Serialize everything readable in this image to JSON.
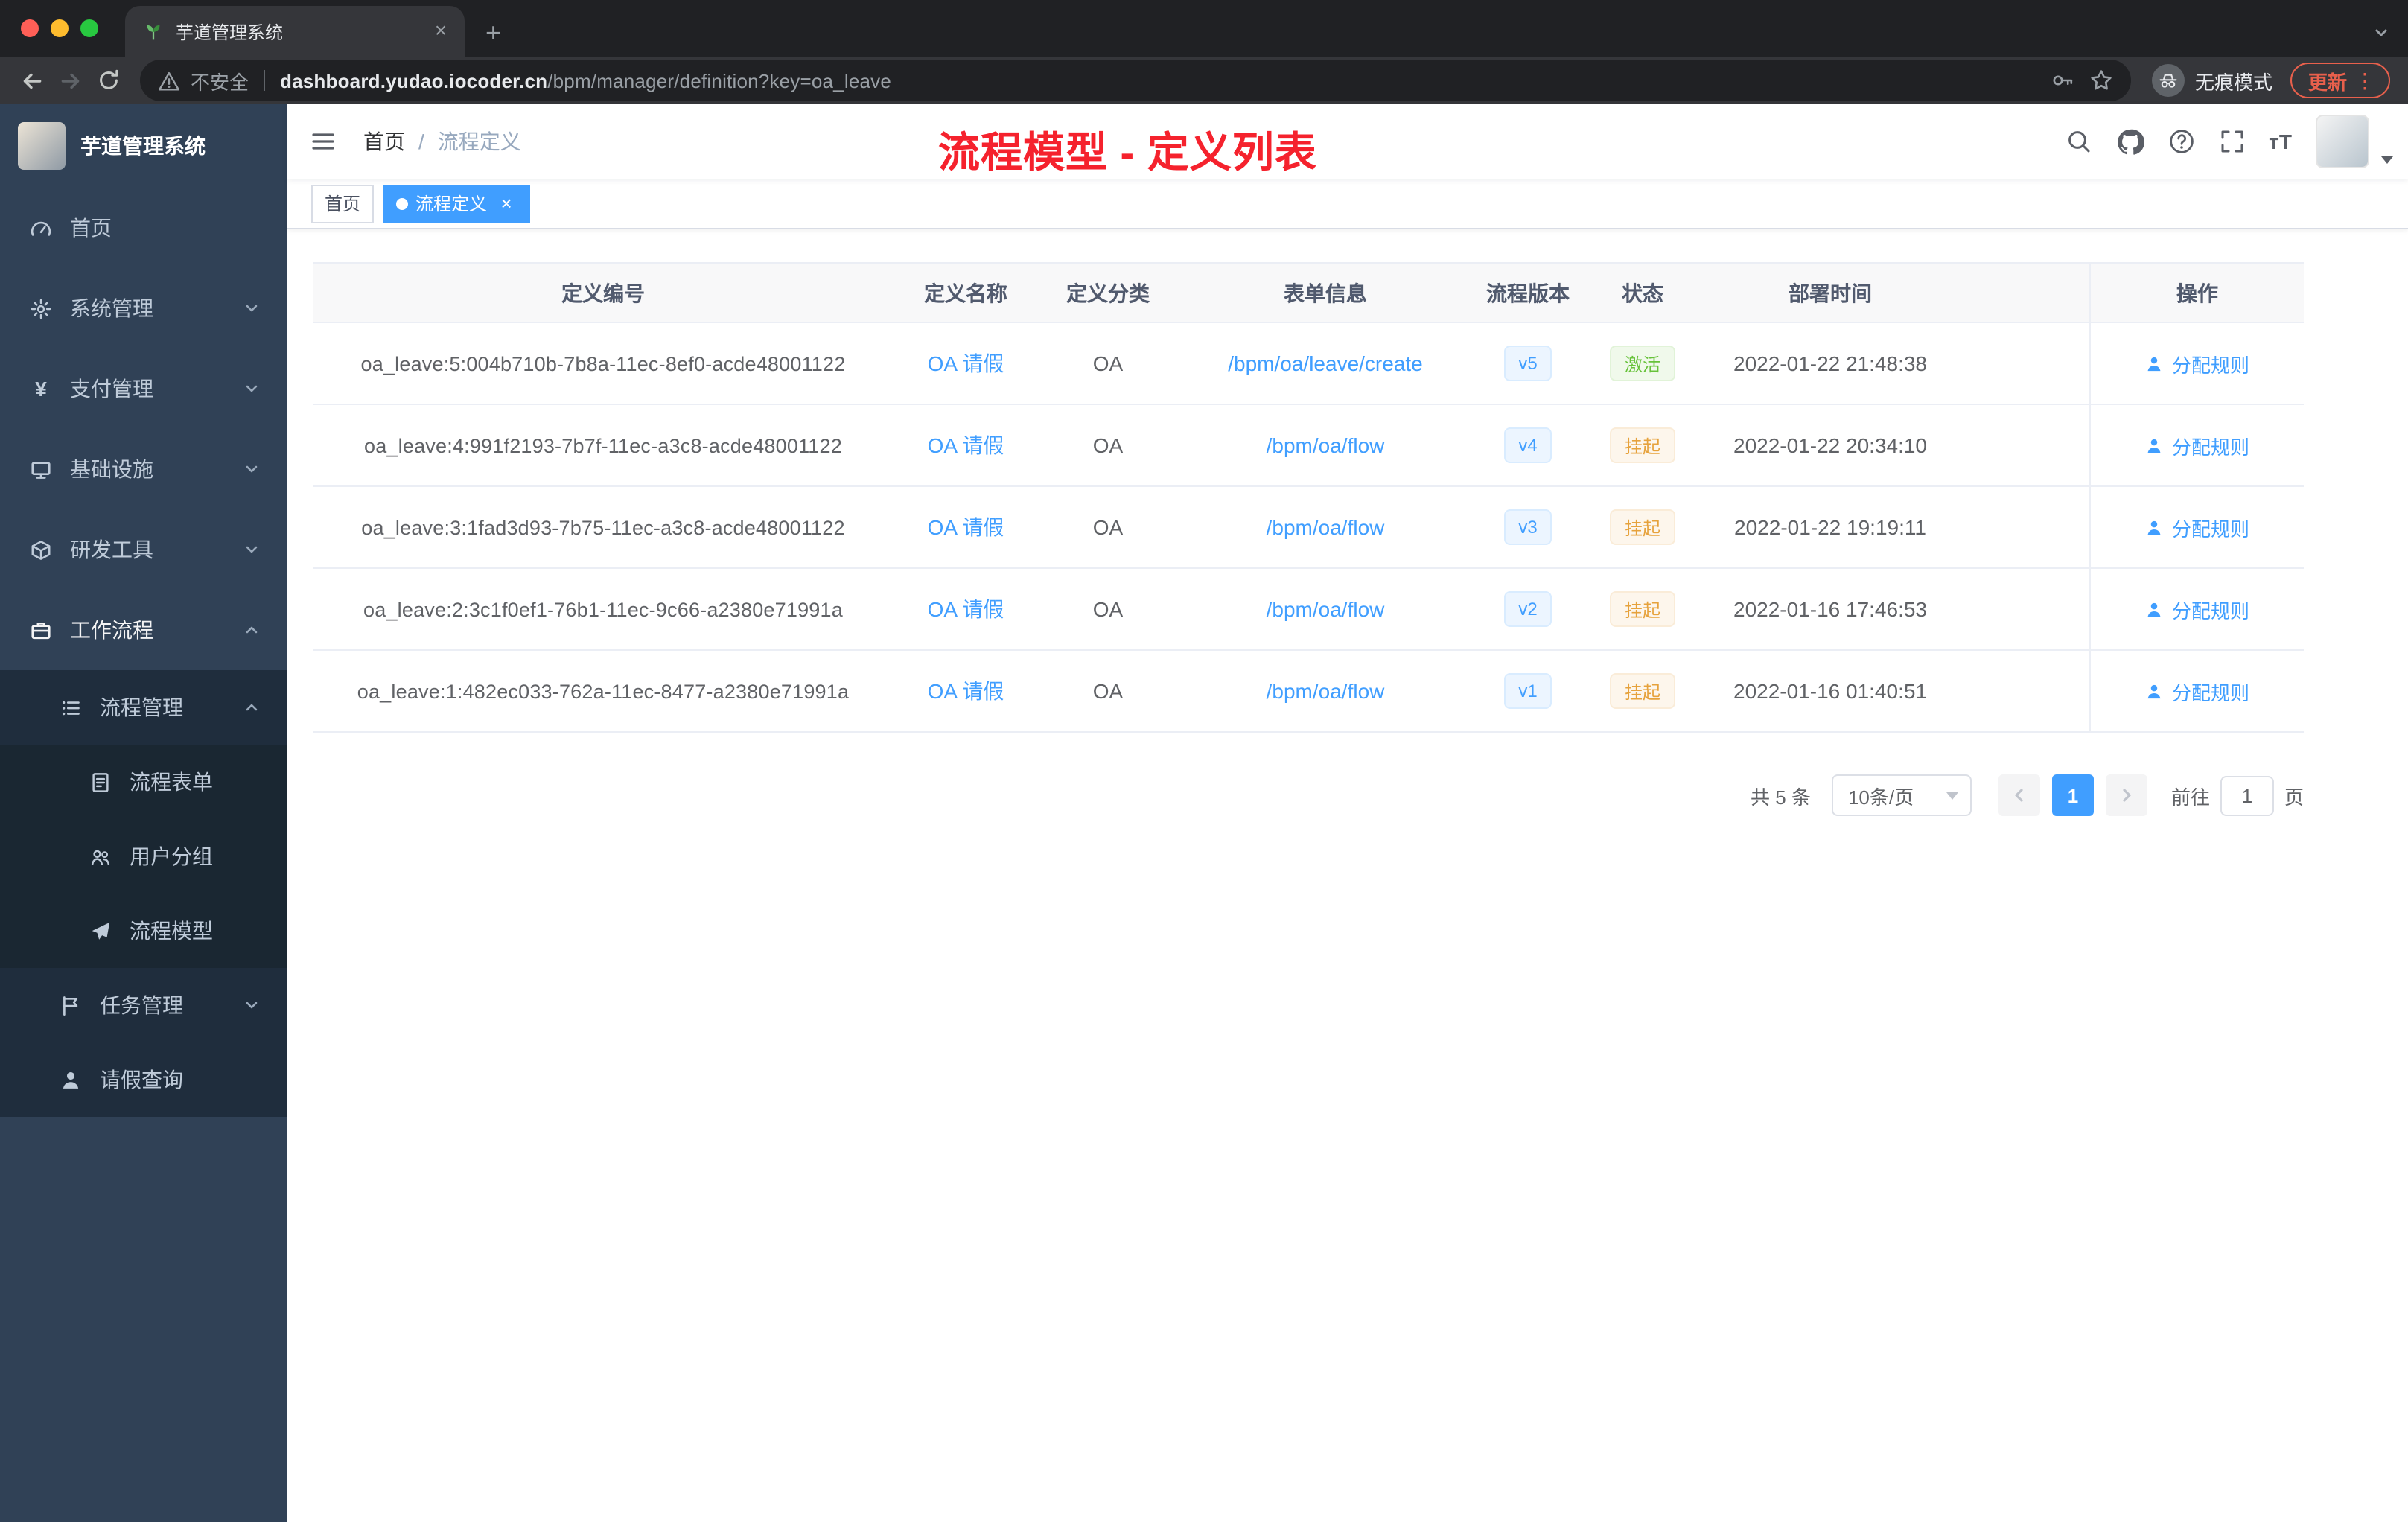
{
  "colors": {
    "accent": "#409eff",
    "success": "#67c23a",
    "warning": "#e6a23c",
    "annotation_red": "#f5222d",
    "sidebar_bg": "#304156",
    "sidebar_submenu_bg": "#1f2d3d",
    "update_pill": "#e8604c"
  },
  "browser": {
    "tab_title": "芋道管理系统",
    "security_label": "不安全",
    "url_host": "dashboard.yudao.iocoder.cn",
    "url_path": "/bpm/manager/definition?key=oa_leave",
    "incognito_label": "无痕模式",
    "update_label": "更新"
  },
  "sidebar": {
    "logo_title": "芋道管理系统",
    "items": [
      {
        "label": "首页",
        "icon": "dashboard-icon"
      },
      {
        "label": "系统管理",
        "icon": "gear-icon"
      },
      {
        "label": "支付管理",
        "icon": "yen-icon"
      },
      {
        "label": "基础设施",
        "icon": "infrastructure-icon"
      },
      {
        "label": "研发工具",
        "icon": "tools-icon"
      },
      {
        "label": "工作流程",
        "icon": "workflow-icon"
      },
      {
        "label": "流程管理",
        "icon": "process-icon"
      },
      {
        "label": "流程表单",
        "icon": "form-icon"
      },
      {
        "label": "用户分组",
        "icon": "user-group-icon"
      },
      {
        "label": "流程模型",
        "icon": "model-icon"
      },
      {
        "label": "任务管理",
        "icon": "task-icon"
      },
      {
        "label": "请假查询",
        "icon": "leave-query-icon"
      }
    ]
  },
  "navbar": {
    "breadcrumb_home": "首页",
    "breadcrumb_separator": "/",
    "breadcrumb_current": "流程定义",
    "annotation": "流程模型 - 定义列表"
  },
  "tags_view": {
    "home": "首页",
    "current": "流程定义"
  },
  "table": {
    "columns": [
      "定义编号",
      "定义名称",
      "定义分类",
      "表单信息",
      "流程版本",
      "状态",
      "部署时间",
      "操作"
    ],
    "rows": [
      {
        "id": "oa_leave:5:004b710b-7b8a-11ec-8ef0-acde48001122",
        "name": "OA 请假",
        "category": "OA",
        "form": "/bpm/oa/leave/create",
        "version": "v5",
        "status": "激活",
        "time": "2022-01-22 21:48:38",
        "action": "分配规则"
      },
      {
        "id": "oa_leave:4:991f2193-7b7f-11ec-a3c8-acde48001122",
        "name": "OA 请假",
        "category": "OA",
        "form": "/bpm/oa/flow",
        "version": "v4",
        "status": "挂起",
        "time": "2022-01-22 20:34:10",
        "action": "分配规则"
      },
      {
        "id": "oa_leave:3:1fad3d93-7b75-11ec-a3c8-acde48001122",
        "name": "OA 请假",
        "category": "OA",
        "form": "/bpm/oa/flow",
        "version": "v3",
        "status": "挂起",
        "time": "2022-01-22 19:19:11",
        "action": "分配规则"
      },
      {
        "id": "oa_leave:2:3c1f0ef1-76b1-11ec-9c66-a2380e71991a",
        "name": "OA 请假",
        "category": "OA",
        "form": "/bpm/oa/flow",
        "version": "v2",
        "status": "挂起",
        "time": "2022-01-16 17:46:53",
        "action": "分配规则"
      },
      {
        "id": "oa_leave:1:482ec033-762a-11ec-8477-a2380e71991a",
        "name": "OA 请假",
        "category": "OA",
        "form": "/bpm/oa/flow",
        "version": "v1",
        "status": "挂起",
        "time": "2022-01-16 01:40:51",
        "action": "分配规则"
      }
    ]
  },
  "pagination": {
    "total": "共 5 条",
    "page_size": "10条/页",
    "current_page": "1",
    "goto_label": "前往",
    "goto_value": "1",
    "page_unit": "页"
  }
}
